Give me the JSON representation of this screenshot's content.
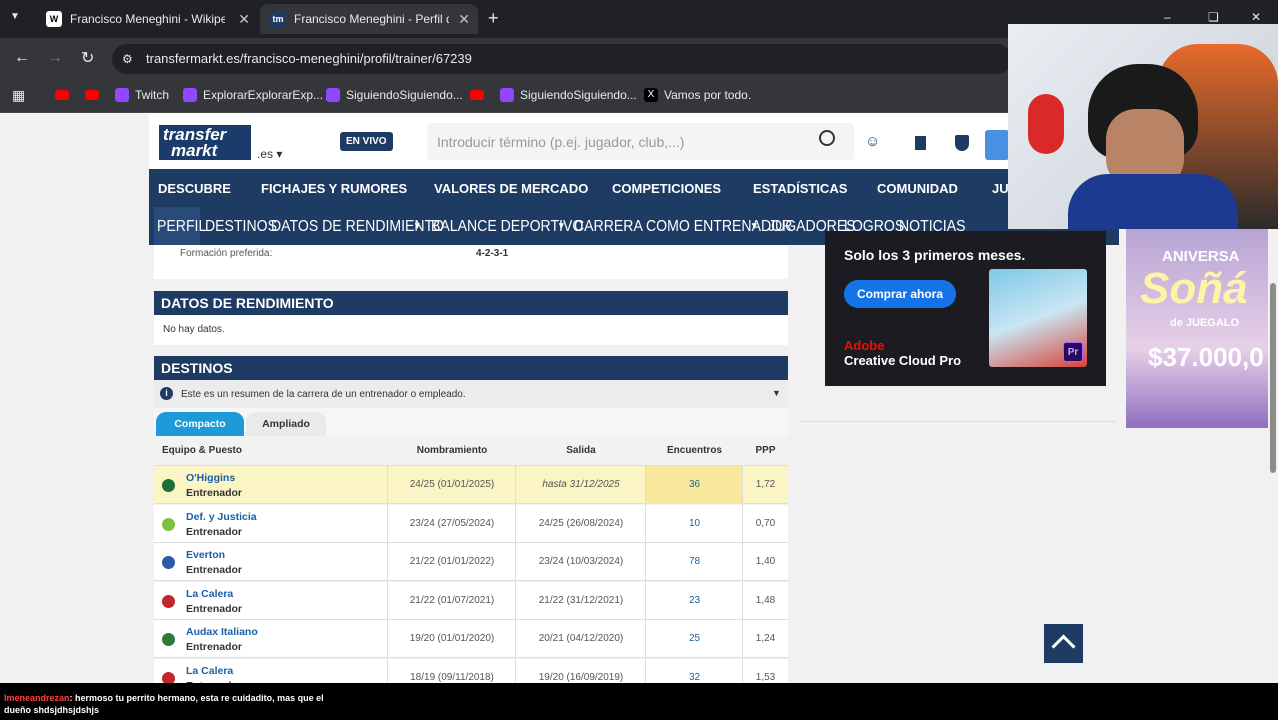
{
  "browser": {
    "tabs": [
      {
        "title": "Francisco Meneghini - Wikipedia",
        "icon": "W"
      },
      {
        "title": "Francisco Meneghini - Perfil de",
        "icon": "tm"
      }
    ],
    "new_tab": "+",
    "url": "transfermarkt.es/francisco-meneghini/profil/trainer/67239",
    "bookmarks": [
      "Twitch",
      "ExplorarExplorarExp...",
      "SiguiendoSiguiendo...",
      "SiguiendoSiguiendo...",
      "Vamos por todo."
    ]
  },
  "header": {
    "logo_line1": "transfer",
    "logo_line2": "markt",
    "domain": ".es",
    "live_badge": "EN VIVO",
    "search_placeholder": "Introducir término (p.ej. jugador, club,...)"
  },
  "nav_main": [
    "DESCUBRE",
    "FICHAJES Y RUMORES",
    "VALORES DE MERCADO",
    "COMPETICIONES",
    "ESTADÍSTICAS",
    "COMUNIDAD",
    "JU"
  ],
  "nav_sub": [
    "PERFIL",
    "DESTINOS",
    "DATOS DE RENDIMIENTO",
    "BALANCE DEPORTIVO",
    "CARRERA COMO ENTRENADOR",
    "JUGADORES",
    "LOGROS",
    "NOTICIAS"
  ],
  "formation": {
    "label": "Formación preferida:",
    "value": "4-2-3-1"
  },
  "performance": {
    "title": "DATOS DE RENDIMIENTO",
    "empty": "No hay datos."
  },
  "destinations": {
    "title": "DESTINOS",
    "info": "Este es un resumen de la carrera de un entrenador o empleado.",
    "tab_compact": "Compacto",
    "tab_extended": "Ampliado",
    "columns": [
      "Equipo & Puesto",
      "Nombramiento",
      "Salida",
      "Encuentros",
      "PPP"
    ],
    "rows": [
      {
        "club": "O'Higgins",
        "role": "Entrenador",
        "start": "24/25 (01/01/2025)",
        "end": "hasta 31/12/2025",
        "games": "36",
        "ppp": "1,72",
        "crest": "#1f6e3a"
      },
      {
        "club": "Def. y Justicia",
        "role": "Entrenador",
        "start": "23/24 (27/05/2024)",
        "end": "24/25 (26/08/2024)",
        "games": "10",
        "ppp": "0,70",
        "crest": "#7cc242"
      },
      {
        "club": "Everton",
        "role": "Entrenador",
        "start": "21/22 (01/01/2022)",
        "end": "23/24 (10/03/2024)",
        "games": "78",
        "ppp": "1,40",
        "crest": "#2a5aa8"
      },
      {
        "club": "La Calera",
        "role": "Entrenador",
        "start": "21/22 (01/07/2021)",
        "end": "21/22 (31/12/2021)",
        "games": "23",
        "ppp": "1,48",
        "crest": "#c0282d"
      },
      {
        "club": "Audax Italiano",
        "role": "Entrenador",
        "start": "19/20 (01/01/2020)",
        "end": "20/21 (04/12/2020)",
        "games": "25",
        "ppp": "1,24",
        "crest": "#2d7a3a"
      },
      {
        "club": "La Calera",
        "role": "Entrenador",
        "start": "18/19 (09/11/2018)",
        "end": "19/20 (16/09/2019)",
        "games": "32",
        "ppp": "1,53",
        "crest": "#c0282d"
      }
    ]
  },
  "ad": {
    "line1": "Solo los 3 primeros meses.",
    "button": "Comprar ahora",
    "brand": "Adobe",
    "product": "Creative Cloud Pro",
    "badge": "Pr"
  },
  "ad2": {
    "line1": "ANIVERSA",
    "line2": "Soñá",
    "line3": "de JUEGALO",
    "price": "$37.000,0"
  },
  "chat": {
    "user": "lmeneandrezan",
    "message": ": hermoso tu perrito hermano, esta re cuidadito, mas que el",
    "message2": "dueño shdsjdhsjdshjs"
  }
}
